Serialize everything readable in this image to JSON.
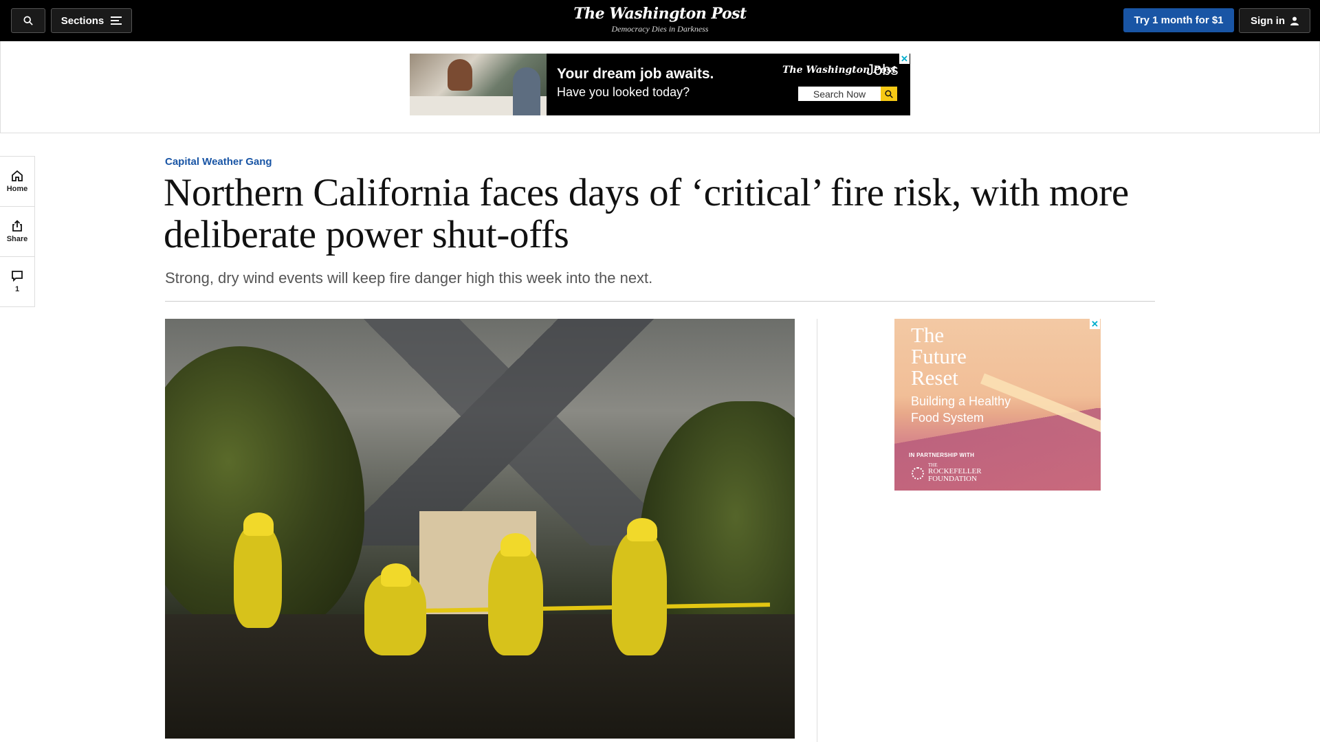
{
  "header": {
    "sections_label": "Sections",
    "logo": "The Washington Post",
    "tagline": "Democracy Dies in Darkness",
    "try_label": "Try 1 month for $1",
    "signin_label": "Sign in",
    "search_icon": "search-icon",
    "menu_icon": "hamburger-icon",
    "user_icon": "user-icon"
  },
  "top_ad": {
    "headline": "Your dream job awaits.",
    "subline": "Have you looked today?",
    "brand": "The Washington Post",
    "brand_suffix": "Jobs",
    "search_label": "Search Now",
    "close_glyph": "✕"
  },
  "rail": {
    "home_label": "Home",
    "share_label": "Share",
    "comments_count": "1"
  },
  "article": {
    "kicker": "Capital Weather Gang",
    "headline": "Northern California faces days of ‘critical’ fire risk, with more deliberate power shut-offs",
    "dek": "Strong, dry wind events will keep fire danger high this week into the next."
  },
  "side_ad": {
    "title_line1": "The",
    "title_line2": "Future",
    "title_line3": "Reset",
    "subtitle_line1": "Building a Healthy",
    "subtitle_line2": "Food System",
    "partner": "IN PARTNERSHIP WITH",
    "foundation_line1": "THE",
    "foundation_line2": "ROCKEFELLER",
    "foundation_line3": "FOUNDATION",
    "close_glyph": "✕"
  },
  "colors": {
    "accent": "#1955a5",
    "topbar": "#000000",
    "ad_search_button": "#f6c915"
  }
}
